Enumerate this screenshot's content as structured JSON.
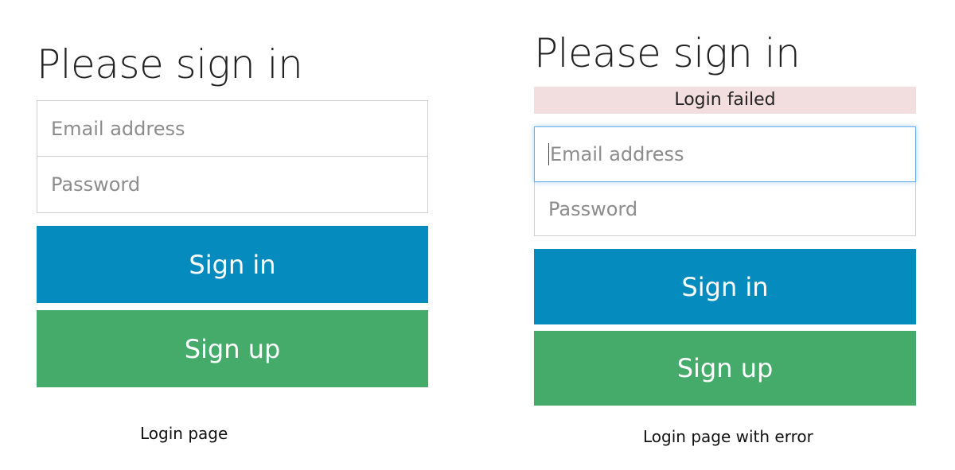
{
  "login_page": {
    "title": "Please sign in",
    "email_placeholder": "Email address",
    "password_placeholder": "Password",
    "signin_label": "Sign in",
    "signup_label": "Sign up",
    "caption": "Login page"
  },
  "login_error_page": {
    "title": "Please sign in",
    "error_message": "Login failed",
    "email_placeholder": "Email address",
    "password_placeholder": "Password",
    "signin_label": "Sign in",
    "signup_label": "Sign up",
    "caption": "Login page with error"
  },
  "colors": {
    "primary": "#058bbd",
    "success": "#45ab6a",
    "error_bg": "#f2dedf",
    "focus_border": "#66afe9"
  }
}
